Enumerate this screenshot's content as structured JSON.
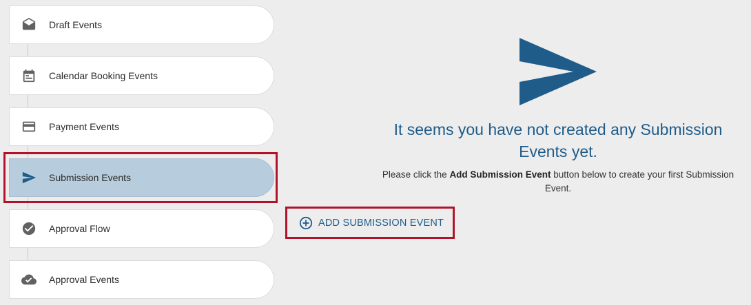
{
  "sidebar": {
    "items": [
      {
        "label": "Draft Events",
        "icon": "envelope-open-icon"
      },
      {
        "label": "Calendar Booking Events",
        "icon": "calendar-icon"
      },
      {
        "label": "Payment Events",
        "icon": "credit-card-icon"
      },
      {
        "label": "Submission Events",
        "icon": "send-icon",
        "active": true
      },
      {
        "label": "Approval Flow",
        "icon": "check-circle-icon"
      },
      {
        "label": "Approval Events",
        "icon": "cloud-check-icon"
      }
    ]
  },
  "main": {
    "big_icon": "send-icon",
    "headline": "It seems you have not created any Submission Events yet.",
    "subtext_prefix": "Please click the ",
    "subtext_bold": "Add Submission Event",
    "subtext_suffix": " button below to create your first Submission Event.",
    "add_button": {
      "label": "ADD SUBMISSION EVENT",
      "icon": "plus-circle-icon"
    }
  },
  "colors": {
    "accent": "#1f5c89",
    "active_bg": "#b7cddd",
    "highlight": "#b0132a",
    "icon_gray": "#616161",
    "page_bg": "#ededed"
  }
}
